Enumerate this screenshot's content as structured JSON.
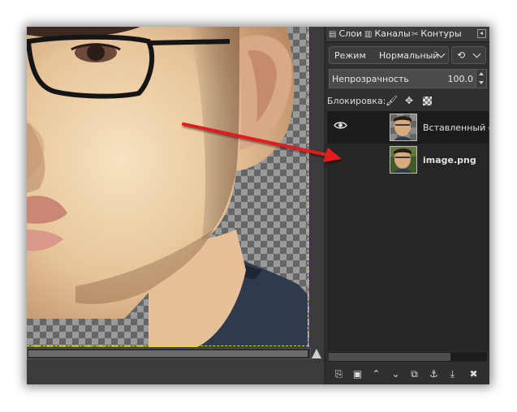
{
  "panel": {
    "tabs": [
      {
        "label": "Слои",
        "icon": "layers-icon"
      },
      {
        "label": "Каналы",
        "icon": "channels-icon"
      },
      {
        "label": "Контуры",
        "icon": "paths-icon"
      }
    ],
    "mode_label": "Режим",
    "mode_value": "Нормальный",
    "opacity_label": "Непрозрачность",
    "opacity_value": "100.0",
    "lock_label": "Блокировка:",
    "layers": [
      {
        "name": "Вставленный сл",
        "visible": true,
        "bold": false,
        "selected": true
      },
      {
        "name": "image.png",
        "visible": false,
        "bold": true,
        "selected": false
      }
    ],
    "toolbar_icons": [
      "new-layer-icon",
      "new-group-icon",
      "raise-icon",
      "lower-icon",
      "duplicate-icon",
      "anchor-icon",
      "merge-down-icon",
      "delete-icon"
    ]
  },
  "colors": {
    "arrow": "#e21b1b",
    "panel_bg": "#2f2f2f",
    "canvas_boundary": "#e8e000"
  }
}
